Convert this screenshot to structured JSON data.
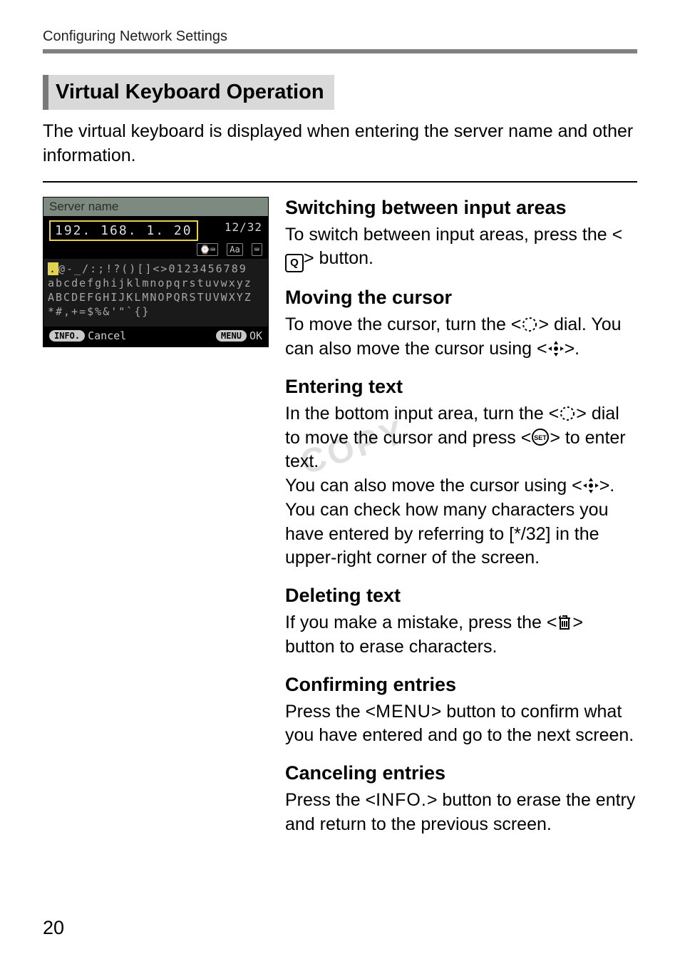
{
  "header": {
    "running": "Configuring Network Settings"
  },
  "title": "Virtual Keyboard Operation",
  "intro": "The virtual keyboard is displayed when entering the server name and other information.",
  "screenshot": {
    "panel_title": "Server name",
    "input_value": "192. 168. 1. 20",
    "count": "12/32",
    "toggles": [
      "⌚⌨",
      "Aa",
      "⌨"
    ],
    "row1_hl": ".",
    "row1_rest": "@-_/:;!?()[]<>0123456789",
    "row2": "abcdefghijklmnopqrstuvwxyz",
    "row3": "ABCDEFGHIJKLMNOPQRSTUVWXYZ",
    "row4": "*#,+=$%&'\"`{}",
    "foot_info": "INFO.",
    "foot_cancel": "Cancel",
    "foot_menu": "MENU",
    "foot_ok": "OK"
  },
  "sections": {
    "switch": {
      "h": "Switching between input areas",
      "p1a": "To switch between input areas, press the <",
      "p1b": "> button.",
      "btn": "Q"
    },
    "move": {
      "h": "Moving the cursor",
      "p1a": "To move the cursor, turn the <",
      "p1b": "> dial. You can also move the cursor using <",
      "p1c": ">."
    },
    "enter": {
      "h": "Entering text",
      "p1a": "In the bottom input area, turn the <",
      "p1b": "> dial to move the cursor and press <",
      "p1c": "> to enter text.",
      "p2a": "You can also move the cursor using <",
      "p2b": ">.",
      "p3": "You can check how many characters you have entered by referring to [*/32] in the upper-right corner of the screen."
    },
    "delete": {
      "h": "Deleting text",
      "p1a": "If you make a mistake, press the <",
      "p1b": "> button to erase characters."
    },
    "confirm": {
      "h": "Confirming entries",
      "p1a": "Press the <",
      "p1b": "> button to confirm what you have entered and go to the next screen.",
      "btn": "MENU"
    },
    "cancel": {
      "h": "Canceling entries",
      "p1a": "Press the <",
      "p1b": "> button to erase the entry and return to the previous screen.",
      "btn": "INFO."
    }
  },
  "watermark": "COPY",
  "page_number": "20"
}
